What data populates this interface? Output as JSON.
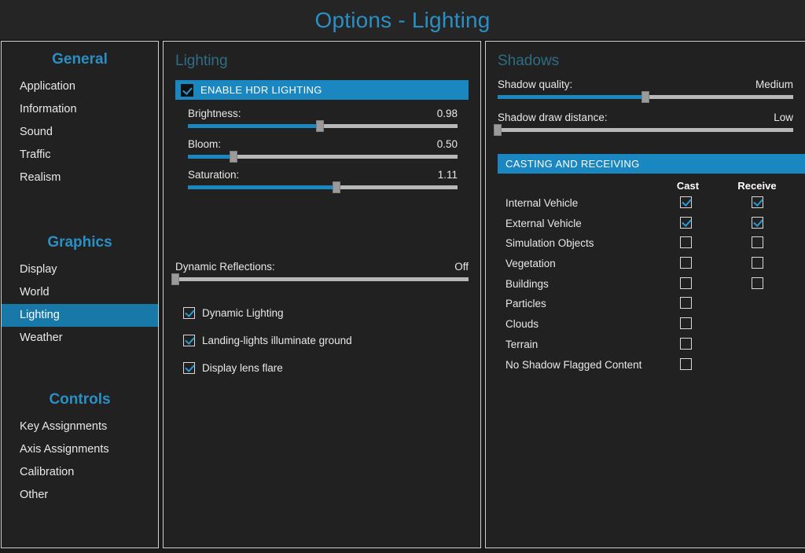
{
  "window": {
    "title": "Options - Lighting",
    "accent": "#1b87c0",
    "title_color": "#2a8fc4",
    "section_header_color": "#2e6d84",
    "background": "#1a1a1a",
    "panel_background": "#212121"
  },
  "sidebar": {
    "groups": [
      {
        "title": "General",
        "items": [
          {
            "label": "Application",
            "selected": false
          },
          {
            "label": "Information",
            "selected": false
          },
          {
            "label": "Sound",
            "selected": false
          },
          {
            "label": "Traffic",
            "selected": false
          },
          {
            "label": "Realism",
            "selected": false
          }
        ]
      },
      {
        "title": "Graphics",
        "items": [
          {
            "label": "Display",
            "selected": false
          },
          {
            "label": "World",
            "selected": false
          },
          {
            "label": "Lighting",
            "selected": true
          },
          {
            "label": "Weather",
            "selected": false
          }
        ]
      },
      {
        "title": "Controls",
        "items": [
          {
            "label": "Key Assignments",
            "selected": false
          },
          {
            "label": "Axis Assignments",
            "selected": false
          },
          {
            "label": "Calibration",
            "selected": false
          },
          {
            "label": "Other",
            "selected": false
          }
        ]
      }
    ]
  },
  "lighting": {
    "section_title": "Lighting",
    "hdr_banner": {
      "label": "ENABLE HDR LIGHTING",
      "checked": true
    },
    "sliders": [
      {
        "label": "Brightness:",
        "value": "0.98",
        "percent": 49
      },
      {
        "label": "Bloom:",
        "value": "0.50",
        "percent": 17
      },
      {
        "label": "Saturation:",
        "value": "1.11",
        "percent": 55
      }
    ],
    "dynamic_reflections": {
      "label": "Dynamic Reflections:",
      "value": "Off",
      "percent": 0
    },
    "checkboxes": [
      {
        "label": "Dynamic Lighting",
        "checked": true
      },
      {
        "label": "Landing-lights illuminate ground",
        "checked": true
      },
      {
        "label": "Display lens flare",
        "checked": true
      }
    ]
  },
  "shadows": {
    "section_title": "Shadows",
    "sliders": [
      {
        "label": "Shadow quality:",
        "value": "Medium",
        "percent": 50
      },
      {
        "label": "Shadow draw distance:",
        "value": "Low",
        "percent": 0
      }
    ],
    "casting_banner": {
      "label": "CASTING AND RECEIVING"
    },
    "table": {
      "columns": [
        "Cast",
        "Receive"
      ],
      "rows": [
        {
          "label": "Internal Vehicle",
          "cast": true,
          "receive": true,
          "has_receive": true
        },
        {
          "label": "External Vehicle",
          "cast": true,
          "receive": true,
          "has_receive": true
        },
        {
          "label": "Simulation Objects",
          "cast": false,
          "receive": false,
          "has_receive": true
        },
        {
          "label": "Vegetation",
          "cast": false,
          "receive": false,
          "has_receive": true
        },
        {
          "label": "Buildings",
          "cast": false,
          "receive": false,
          "has_receive": true
        },
        {
          "label": "Particles",
          "cast": false,
          "receive": false,
          "has_receive": false
        },
        {
          "label": "Clouds",
          "cast": false,
          "receive": false,
          "has_receive": false
        },
        {
          "label": "Terrain",
          "cast": false,
          "receive": false,
          "has_receive": false
        },
        {
          "label": "No Shadow Flagged Content",
          "cast": false,
          "receive": false,
          "has_receive": false
        }
      ]
    }
  }
}
